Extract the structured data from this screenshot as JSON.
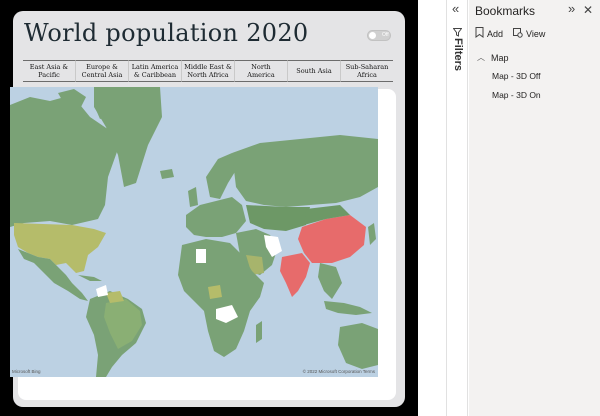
{
  "report": {
    "title": "World population 2020",
    "toggle_label": "Off",
    "regions": [
      "East Asia &\nPacific",
      "Europe &\nCentral Asia",
      "Latin America\n& Caribbean",
      "Middle East &\nNorth Africa",
      "North America",
      "South Asia",
      "Sub-Saharan\nAfrica"
    ]
  },
  "map": {
    "attribution_logo": "Microsoft Bing",
    "copyright": "© 2022 Microsoft Corporation  Terms",
    "colors": {
      "ocean": "#bcd1e3",
      "land": "#7aa276",
      "land_dark": "#5f8a60",
      "north_america_usa": "#b5bc6a",
      "china_india": "#e76b6b",
      "no_data": "#ffffff"
    }
  },
  "filters": {
    "label": "Filters",
    "collapse_icon": "double-chevron-left-icon",
    "filter_icon": "filter-icon"
  },
  "bookmarks": {
    "title": "Bookmarks",
    "add_label": "Add",
    "view_label": "View",
    "group_label": "Map",
    "items": [
      "Map - 3D Off",
      "Map - 3D On"
    ]
  }
}
